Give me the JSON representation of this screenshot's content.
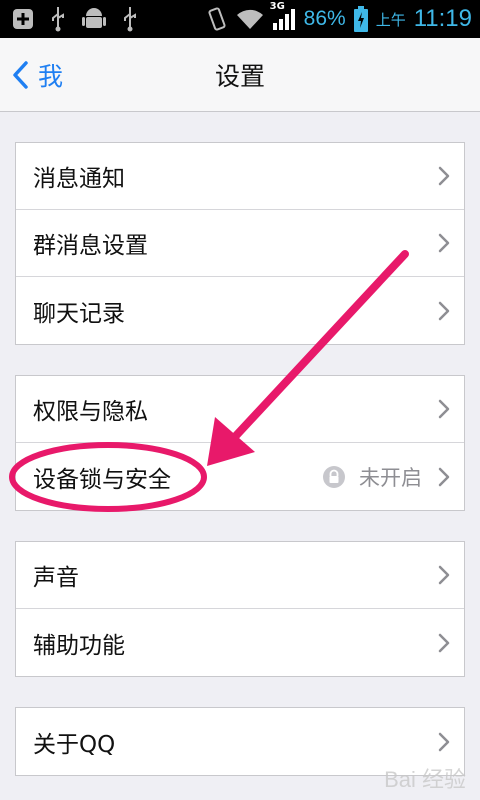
{
  "status_bar": {
    "battery_percent_text": "86%",
    "am_pm": "上午",
    "time": "11:19",
    "network_type": "3G",
    "icons": [
      "add-notification-icon",
      "usb-icon",
      "android-debug-icon",
      "usb-icon",
      "vibrate-icon",
      "wifi-icon",
      "signal-icon",
      "battery-charging-icon"
    ]
  },
  "nav": {
    "back_label": "我",
    "title": "设置"
  },
  "groups": [
    {
      "items": [
        {
          "label": "消息通知"
        },
        {
          "label": "群消息设置"
        },
        {
          "label": "聊天记录"
        }
      ]
    },
    {
      "items": [
        {
          "label": "权限与隐私"
        },
        {
          "label": "设备锁与安全",
          "value": "未开启"
        }
      ]
    },
    {
      "items": [
        {
          "label": "声音"
        },
        {
          "label": "辅助功能"
        }
      ]
    },
    {
      "items": [
        {
          "label": "关于QQ"
        }
      ]
    }
  ],
  "colors": {
    "accent": "#1f7ff2",
    "annotation": "#e8196a",
    "background": "#efeff4"
  },
  "watermark": "Bai 经验"
}
